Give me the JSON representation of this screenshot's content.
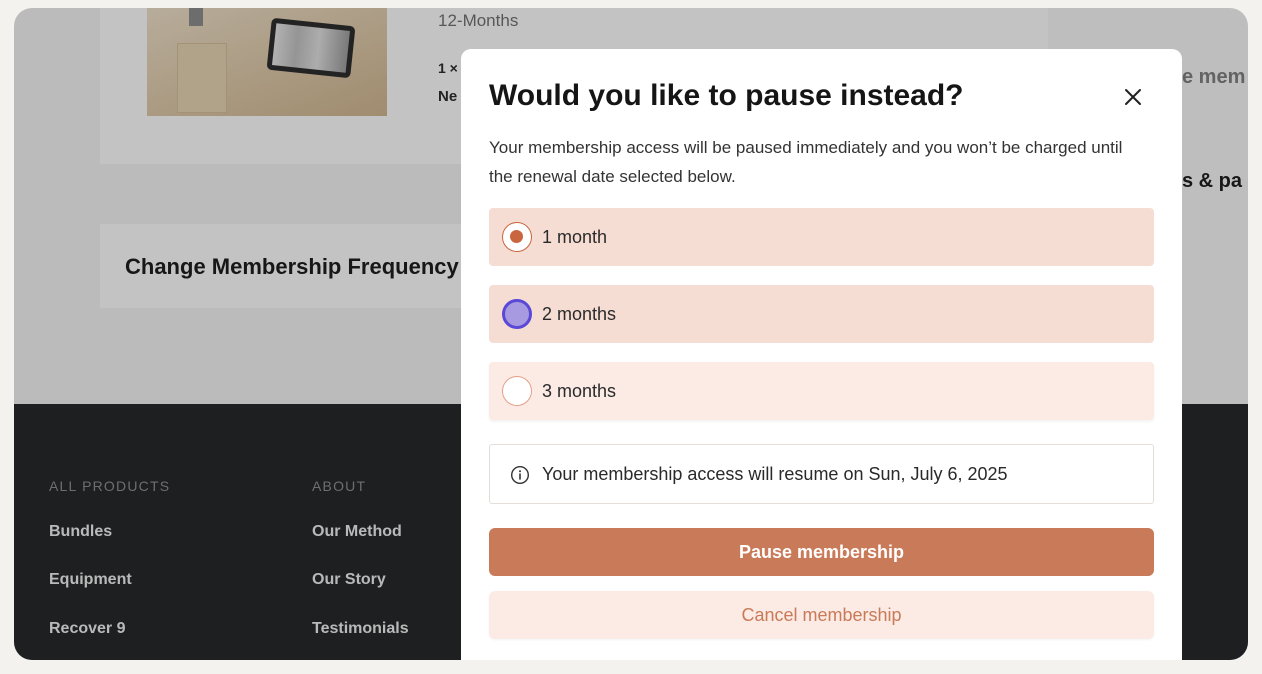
{
  "background": {
    "plan_label": "12-Months",
    "quantity_label": "1 ×",
    "line2_fragment": "Ne",
    "frequency_card_title": "Change Membership Frequency",
    "right_fragment_1": "e mem",
    "right_fragment_2": "s & pa"
  },
  "footer": {
    "columns": [
      {
        "heading": "ALL PRODUCTS",
        "links": [
          "Bundles",
          "Equipment",
          "Recover 9"
        ]
      },
      {
        "heading": "ABOUT",
        "links": [
          "Our Method",
          "Our Story",
          "Testimonials"
        ]
      }
    ]
  },
  "modal": {
    "title": "Would you like to pause instead?",
    "description": "Your membership access will be paused immediately and you won’t be charged until the renewal date selected below.",
    "options": [
      {
        "label": "1 month",
        "selected": true
      },
      {
        "label": "2 months",
        "selected": false,
        "focused": true
      },
      {
        "label": "3 months",
        "selected": false
      }
    ],
    "info_text": "Your membership access will resume on Sun, July 6, 2025",
    "primary_button": "Pause membership",
    "secondary_button": "Cancel membership",
    "icons": {
      "close": "close-icon",
      "info": "info-icon"
    }
  },
  "colors": {
    "accent": "#c97a58",
    "option_bg": "#f6ddd4",
    "focus_ring": "#5a49d6",
    "footer_bg": "#1b1c1e"
  }
}
